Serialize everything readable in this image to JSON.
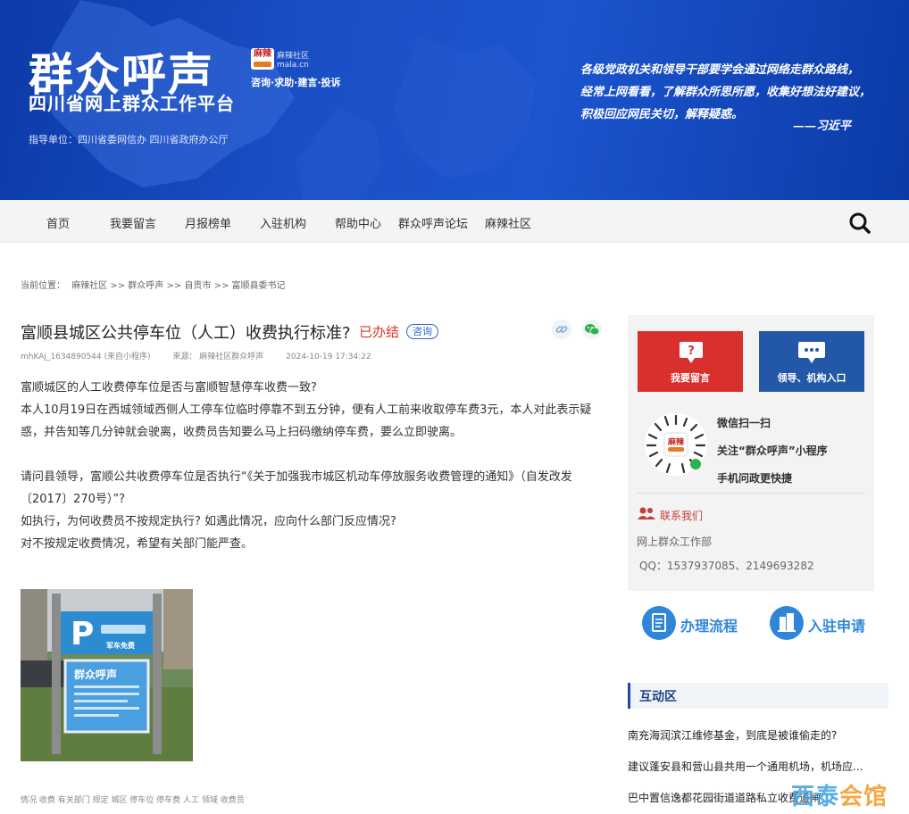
{
  "banner": {
    "title": "群众呼声",
    "logo_text": "麻辣",
    "brand_small_1": "麻辣社区",
    "brand_small_2": "mala.cn",
    "tags": "咨询·求助·建言·投诉",
    "subtitle": "四川省网上群众工作平台",
    "guide": "指导单位：四川省委网信办 四川省政府办公厅",
    "quote_lines": [
      "各级党政机关和领导干部要学会通过网络走群众路线，",
      "经常上网看看，了解群众所思所愿，收集好想法好建议，",
      "积极回应网民关切，解释疑惑。"
    ],
    "quote_author": "——习近平"
  },
  "nav": {
    "items": [
      "首页",
      "我要留言",
      "月报榜单",
      "入驻机构",
      "帮助中心",
      "群众呼声论坛",
      "麻辣社区"
    ]
  },
  "breadcrumb": {
    "label": "当前位置：",
    "trail": "麻辣社区 >> 群众呼声 >> 自贡市 >> 富顺县委书记"
  },
  "post": {
    "title": "富顺县城区公共停车位（人工）收费执行标准?",
    "status": "已办结",
    "badge": "咨询",
    "author": "mhKAj_1634890544 (来自小程序)",
    "source": "来源：  麻辣社区群众呼声",
    "date": "2024-10-19 17:34:22",
    "paragraphs": [
      "富顺城区的人工收费停车位是否与富顺智慧停车收费一致?",
      "本人10月19日在西城领域西侧人工停车位临时停靠不到五分钟，便有人工前来收取停车费3元，本人对此表示疑惑，并告知等几分钟就会驶离，收费员告知要么马上扫码缴纳停车费，要么立即驶离。",
      "",
      "请问县领导，富顺公共收费停车位是否执行“《关于加强我市城区机动车停放服务收费管理的通知》（自发改发〔2017〕270号）”?",
      "如执行，为何收费员不按规定执行? 如遇此情况，应向什么部门反应情况?",
      "对不按规定收费情况，希望有关部门能严查。"
    ],
    "photo_sign_text": "军车免费",
    "photo_board_text": "群众呼声",
    "keywords": "情况 收费 有关部门 规定 城区 停车位 停车费 人工 领域 收费员"
  },
  "sidebar": {
    "btn_message": "我要留言",
    "btn_entry": "领导、机构入口",
    "qr_logo": "麻辣",
    "qr_lines": [
      "微信扫一扫",
      "关注“群众呼声”小程序",
      "手机问政更快捷"
    ],
    "contact_title": "联系我们",
    "contact_dept": "网上群众工作部",
    "contact_qq": "QQ：1537937085、2149693282",
    "flow_label": "办理流程",
    "join_label": "入驻申请",
    "interact_title": "互动区",
    "interact_links": [
      "南充海润滨江维修基金，到底是被谁偷走的?",
      "建议蓬安县和营山县共用一个通用机场，机场应...",
      "巴中置信逸都花园街道道路私立收费道闸"
    ]
  },
  "watermark": {
    "part1": "西泰",
    "part2": "会馆"
  },
  "colors": {
    "brand_blue": "#1a4fc6",
    "status_red": "#d9352b",
    "accent_blue": "#2358a8"
  }
}
